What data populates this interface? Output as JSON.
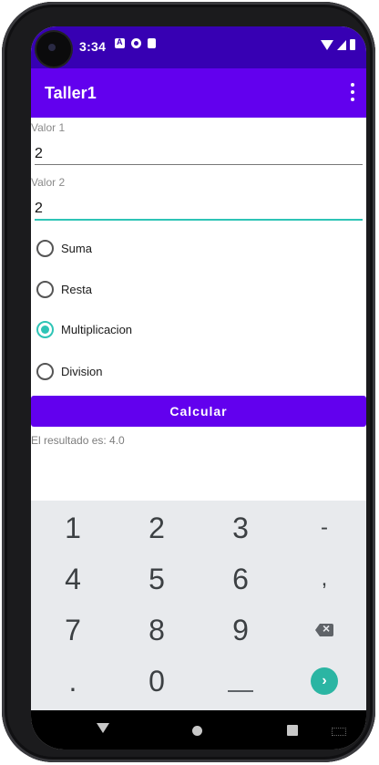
{
  "status_bar": {
    "time": "3:34"
  },
  "app_bar": {
    "title": "Taller1"
  },
  "form": {
    "valor1": {
      "label": "Valor 1",
      "value": "2"
    },
    "valor2": {
      "label": "Valor 2",
      "value": "2"
    },
    "operations": [
      {
        "label": "Suma",
        "checked": false
      },
      {
        "label": "Resta",
        "checked": false
      },
      {
        "label": "Multiplicacion",
        "checked": true
      },
      {
        "label": "Division",
        "checked": false
      }
    ],
    "calc_button": "Calcular",
    "result": "El resultado es: 4.0"
  },
  "keyboard": {
    "rows": [
      [
        "1",
        "2",
        "3",
        "-"
      ],
      [
        "4",
        "5",
        "6",
        ","
      ],
      [
        "7",
        "8",
        "9",
        "backspace-icon"
      ],
      [
        ".",
        "0",
        "space-icon",
        "enter-icon"
      ]
    ]
  },
  "colors": {
    "primary": "#6200ee",
    "primary_dark": "#3700b3",
    "accent": "#2ec4b6"
  }
}
